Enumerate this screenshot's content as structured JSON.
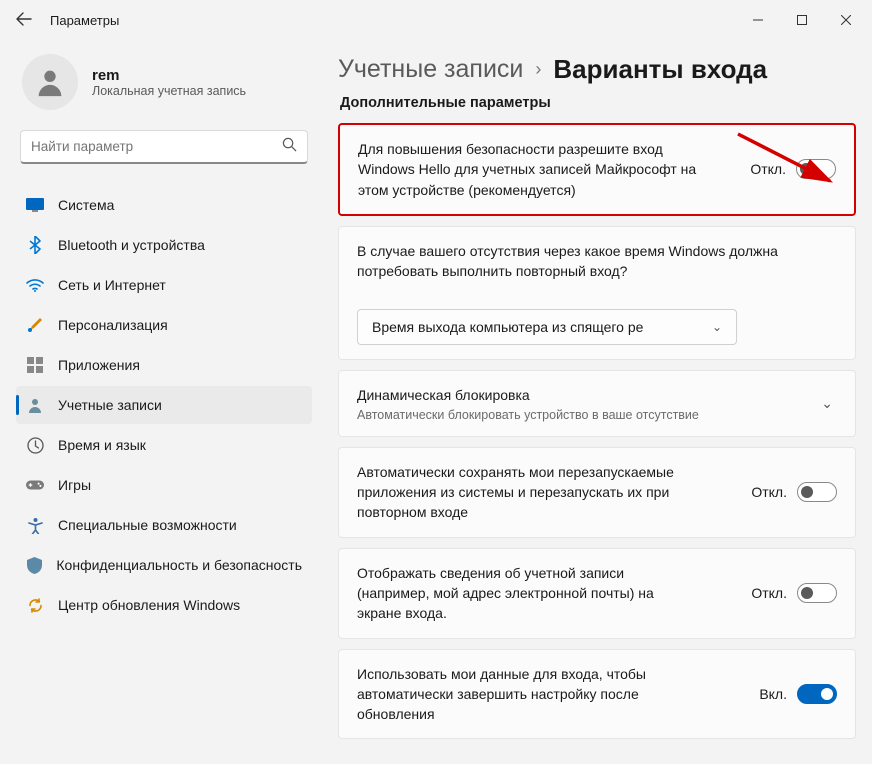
{
  "window": {
    "title": "Параметры"
  },
  "user": {
    "name": "rem",
    "subtitle": "Локальная учетная запись"
  },
  "search": {
    "placeholder": "Найти параметр"
  },
  "sidebar": {
    "items": [
      {
        "label": "Система",
        "icon": "monitor"
      },
      {
        "label": "Bluetooth и устройства",
        "icon": "bluetooth"
      },
      {
        "label": "Сеть и Интернет",
        "icon": "wifi"
      },
      {
        "label": "Персонализация",
        "icon": "brush"
      },
      {
        "label": "Приложения",
        "icon": "apps"
      },
      {
        "label": "Учетные записи",
        "icon": "person",
        "selected": true
      },
      {
        "label": "Время и язык",
        "icon": "clock"
      },
      {
        "label": "Игры",
        "icon": "gamepad"
      },
      {
        "label": "Специальные возможности",
        "icon": "accessibility"
      },
      {
        "label": "Конфиденциальность и безопасность",
        "icon": "shield"
      },
      {
        "label": "Центр обновления Windows",
        "icon": "update"
      }
    ]
  },
  "breadcrumb": {
    "parent": "Учетные записи",
    "current": "Варианты входа"
  },
  "section_title": "Дополнительные параметры",
  "cards": {
    "hello": {
      "text": "Для повышения безопасности разрешите вход Windows Hello для учетных записей Майкрософт на этом устройстве (рекомендуется)",
      "toggle_label": "Откл."
    },
    "absence": {
      "text": "В случае вашего отсутствия через какое время Windows должна потребовать выполнить повторный вход?",
      "dropdown_value": "Время выхода компьютера из спящего ре"
    },
    "dynlock": {
      "title": "Динамическая блокировка",
      "sub": "Автоматически блокировать устройство в ваше отсутствие"
    },
    "autorestart": {
      "text": "Автоматически сохранять мои перезапускаемые приложения из системы и перезапускать их при повторном входе",
      "toggle_label": "Откл."
    },
    "acctinfo": {
      "text": "Отображать сведения об учетной записи (например, мой адрес электронной почты) на экране входа.",
      "toggle_label": "Откл."
    },
    "usemydata": {
      "text": "Использовать мои данные для входа, чтобы автоматически завершить настройку после обновления",
      "toggle_label": "Вкл."
    }
  }
}
